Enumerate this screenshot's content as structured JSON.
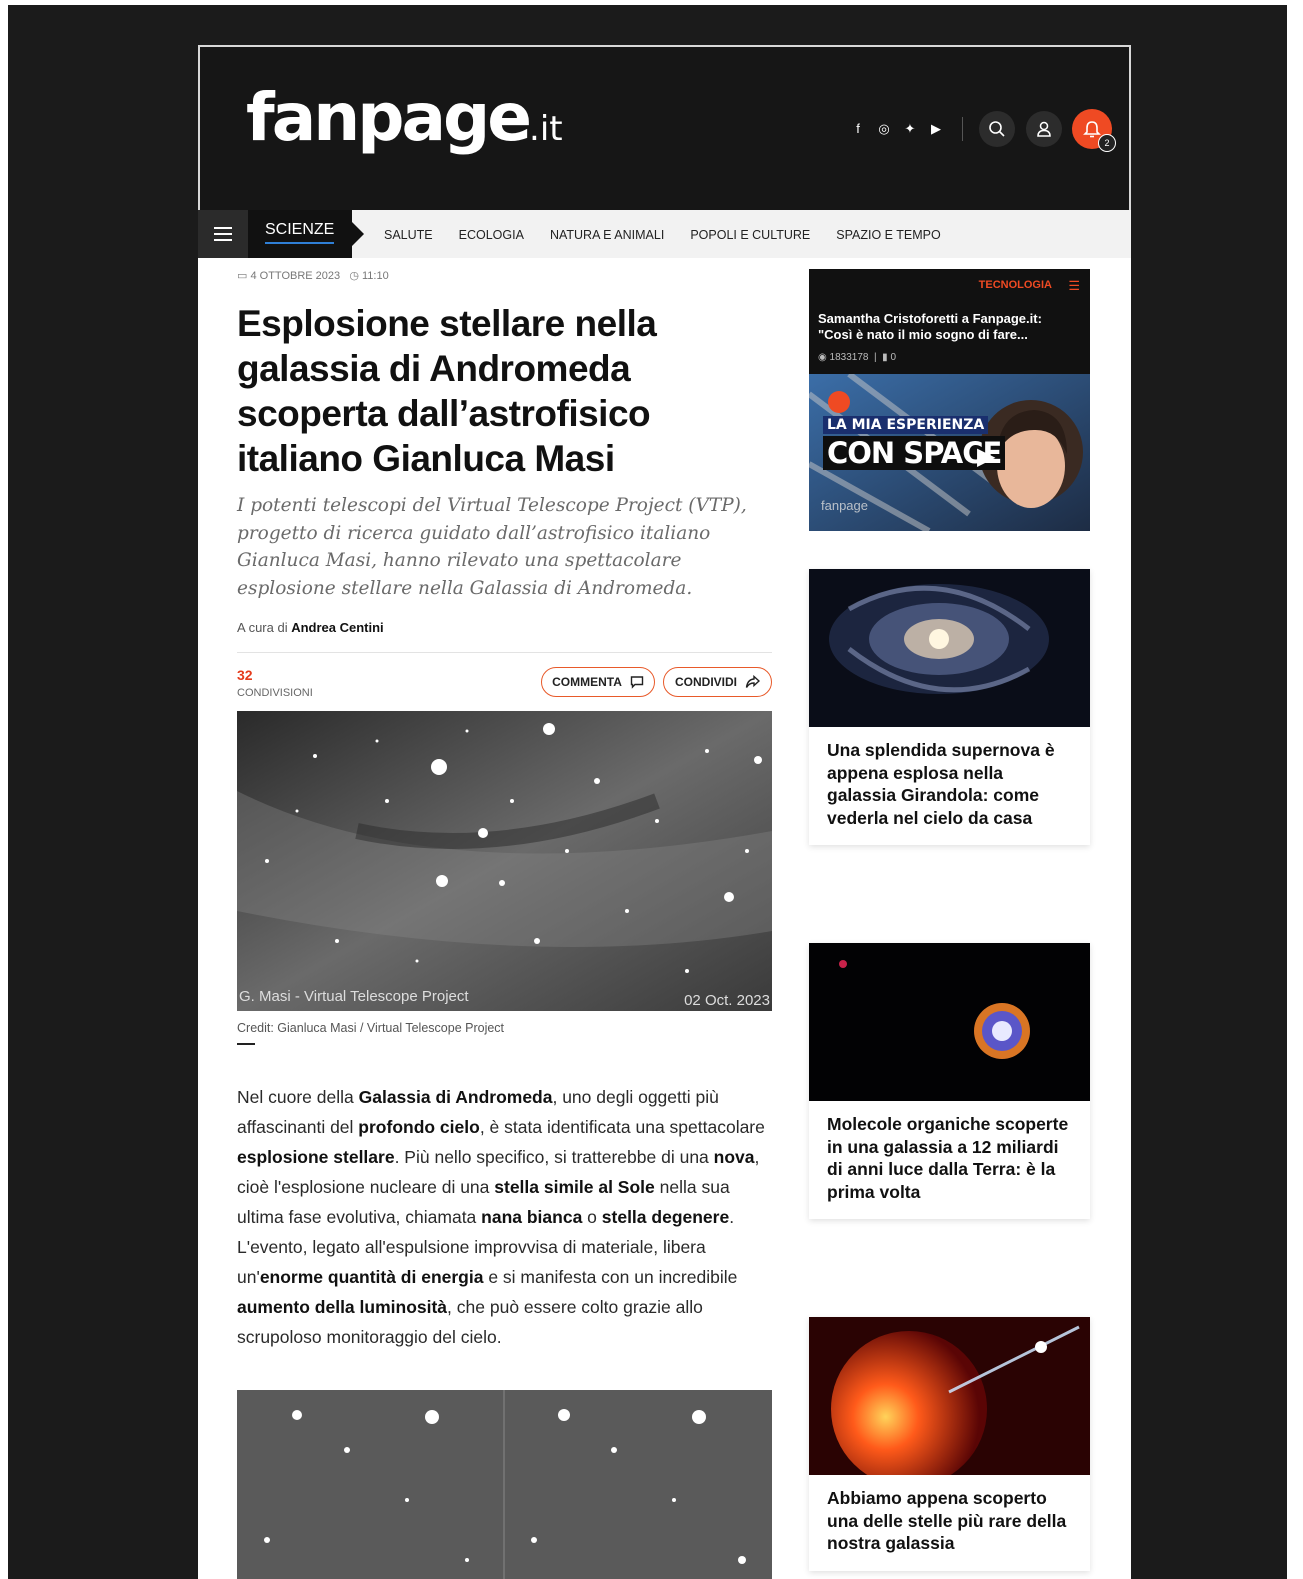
{
  "site": {
    "logo_main": "fanpage",
    "logo_tld": ".it",
    "notification_count": "2"
  },
  "nav": {
    "section": "SCIENZE",
    "links": [
      "SALUTE",
      "ECOLOGIA",
      "NATURA E ANIMALI",
      "POPOLI E CULTURE",
      "SPAZIO E TEMPO"
    ]
  },
  "article": {
    "date": "4 OTTOBRE 2023",
    "time": "11:10",
    "title": "Esplosione stellare nella galassia di Andromeda scoperta dall’astrofisico italiano Gianluca Masi",
    "lead": "I potenti telescopi del Virtual Telescope Project (VTP), progetto di ricerca guidato dall’astrofisico italiano Gianluca Masi, hanno rilevato una spettacolare esplosione stellare nella Galassia di Andromeda.",
    "byline_prefix": "A cura di",
    "author": "Andrea Centini",
    "shares_count": "32",
    "shares_label": "CONDIVISIONI",
    "comment_label": "COMMENTA",
    "share_label": "CONDIVIDI",
    "image_watermark_left": "G. Masi - Virtual Telescope Project",
    "image_watermark_right": "02 Oct. 2023",
    "caption": "Credit: Gianluca Masi / Virtual Telescope Project",
    "body": {
      "p1": "Nel cuore della ",
      "b1": "Galassia di Andromeda",
      "p2": ", uno degli oggetti più affascinanti del ",
      "b2": "profondo cielo",
      "p3": ", è stata identificata una spettacolare ",
      "b3": "esplosione stellare",
      "p4": ". Più nello specifico, si tratterebbe di una ",
      "b4": "nova",
      "p5": ", cioè l'esplosione nucleare di una ",
      "b5": "stella simile al Sole",
      "p6": " nella sua ultima fase evolutiva, chiamata ",
      "b6": "nana bianca",
      "p7": " o ",
      "b7": "stella degenere",
      "p8": ". L'evento, legato all'espulsione improvvisa di materiale, libera un'",
      "b8": "enorme quantità di energia",
      "p9": " e si manifesta con un incredibile ",
      "b9": "aumento della luminosità",
      "p10": ", che può essere colto grazie allo scrupoloso monitoraggio del cielo."
    }
  },
  "sidebar": {
    "promo": {
      "category": "TECNOLOGIA",
      "title": "Samantha Cristoforetti a Fanpage.it: \"Così è nato il mio sogno di fare...",
      "views": "1833178",
      "likes": "0",
      "overlay_line1": "LA MIA ESPERIENZA",
      "overlay_line2": "CON SPACE",
      "overlay_brand": "fanpage"
    },
    "cards": [
      {
        "title": "Una splendida supernova è appena esplosa nella galassia Girandola: come vederla nel cielo da casa"
      },
      {
        "title": "Molecole organiche scoperte in una galassia a 12 miliardi di anni luce dalla Terra: è la prima volta"
      },
      {
        "title": "Abbiamo appena scoperto una delle stelle più rare della nostra galassia"
      }
    ]
  },
  "colors": {
    "accent": "#ef4a23",
    "header_bg": "#161616",
    "nav_underline": "#2f7fd6"
  }
}
